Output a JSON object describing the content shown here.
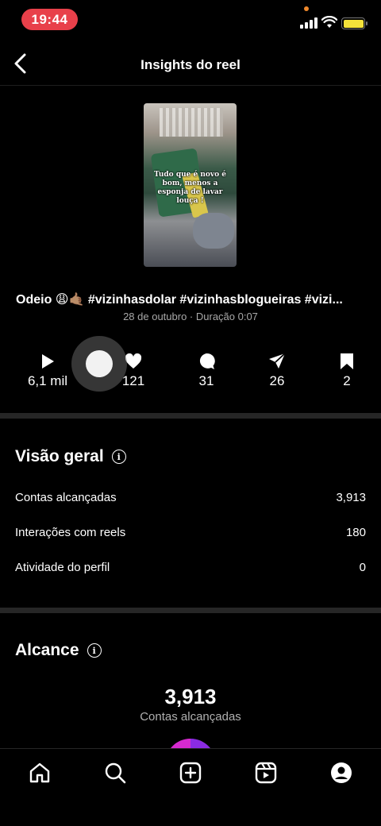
{
  "status_bar": {
    "time": "19:44"
  },
  "header": {
    "title": "Insights do reel"
  },
  "reel": {
    "overlay_text": "Tudo que é novo é bom, menos a esponja de lavar louça !",
    "caption": "Odeio 😩🤙🏽 #vizinhasdolar #vizinhasblogueiras #vizi...",
    "meta": "28 de outubro · Duração 0:07"
  },
  "stats": {
    "plays": "6,1 mil",
    "likes": "121",
    "comments": "31",
    "shares": "26",
    "saves": "2"
  },
  "overview": {
    "title": "Visão geral",
    "rows": [
      {
        "label": "Contas alcançadas",
        "value": "3,913"
      },
      {
        "label": "Interações com reels",
        "value": "180"
      },
      {
        "label": "Atividade do perfil",
        "value": "0"
      }
    ]
  },
  "reach": {
    "title": "Alcance",
    "number": "3,913",
    "label": "Contas alcançadas"
  },
  "nav": [
    "home-icon",
    "search-icon",
    "create-icon",
    "reels-icon",
    "profile-icon"
  ],
  "colors": {
    "accent_time": "#e8404a",
    "battery": "#f4e23a",
    "donut_a": "#8a2be2",
    "donut_b": "#d62ad0"
  }
}
